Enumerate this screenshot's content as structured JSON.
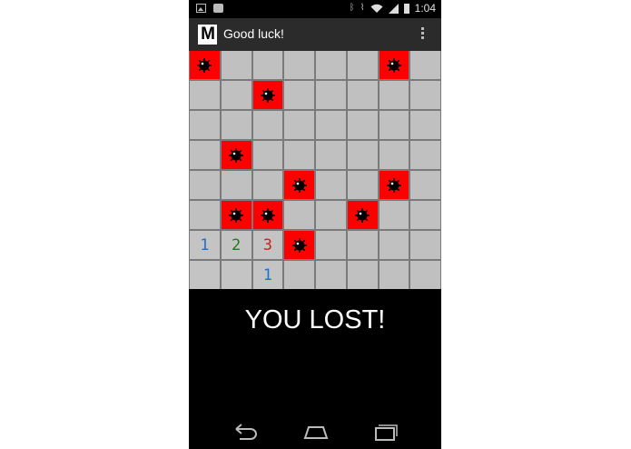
{
  "status_bar": {
    "time": "1:04"
  },
  "action_bar": {
    "logo": "M",
    "title": "Good luck!"
  },
  "board": {
    "rows": 8,
    "cols": 8,
    "cells": [
      [
        "mine",
        "",
        "",
        "",
        "",
        "",
        "mine",
        ""
      ],
      [
        "",
        "",
        "mine",
        "",
        "",
        "",
        "",
        ""
      ],
      [
        "",
        "",
        "",
        "",
        "",
        "",
        "",
        ""
      ],
      [
        "",
        "mine",
        "",
        "",
        "",
        "",
        "",
        ""
      ],
      [
        "",
        "",
        "",
        "mine",
        "",
        "",
        "mine",
        ""
      ],
      [
        "",
        "mine",
        "mine",
        "",
        "",
        "mine",
        "",
        ""
      ],
      [
        "1",
        "2",
        "3",
        "mine",
        "",
        "",
        "",
        ""
      ],
      [
        "open",
        "open",
        "1",
        "",
        "",
        "",
        "",
        ""
      ]
    ]
  },
  "result": {
    "message": "YOU LOST!"
  },
  "colors": {
    "mine_bg": "#ff0000",
    "cell_bg": "#c0c0c0",
    "one": "#1f6fcf",
    "two": "#1f7a1f",
    "three": "#d01f1f"
  }
}
